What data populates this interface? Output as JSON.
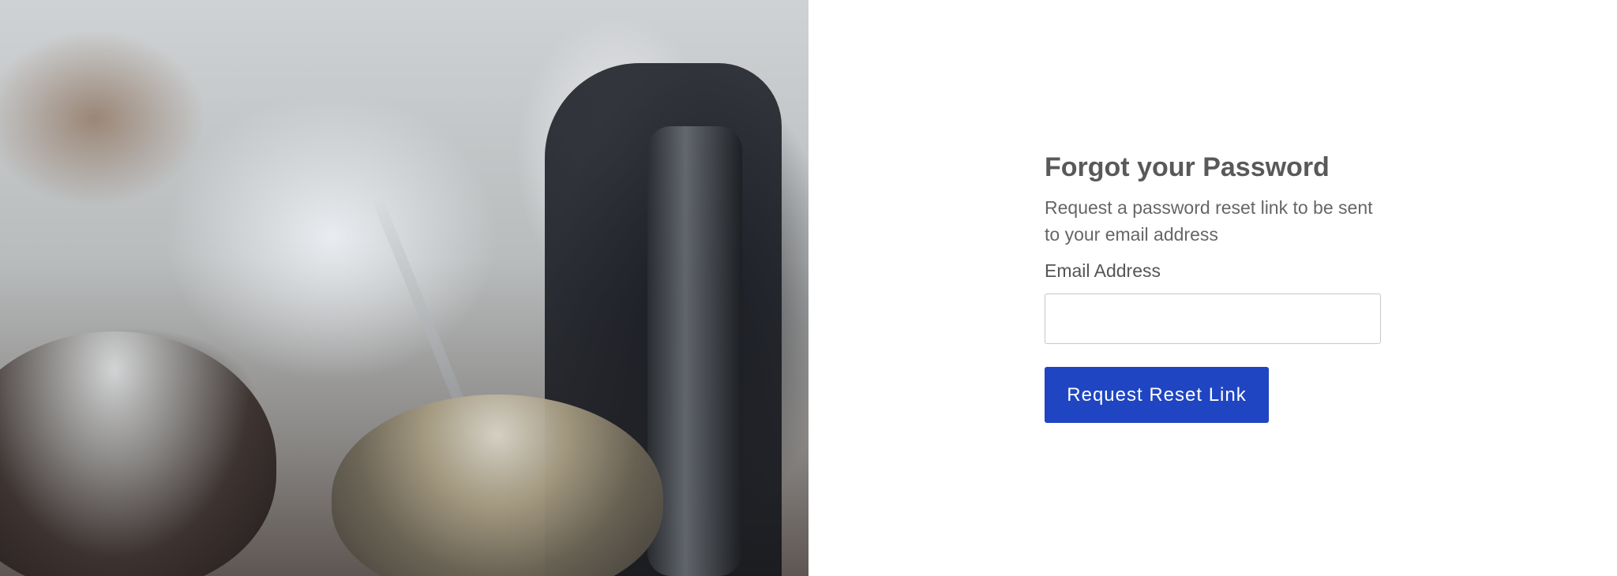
{
  "form": {
    "title": "Forgot your Password",
    "description": "Request a password reset link to be sent to your email address",
    "email_label": "Email Address",
    "email_value": "",
    "email_placeholder": "",
    "submit_label": "Request Reset Link"
  },
  "colors": {
    "accent": "#1f45c2",
    "heading": "#595959",
    "text": "#666666",
    "background": "#ffffff"
  }
}
